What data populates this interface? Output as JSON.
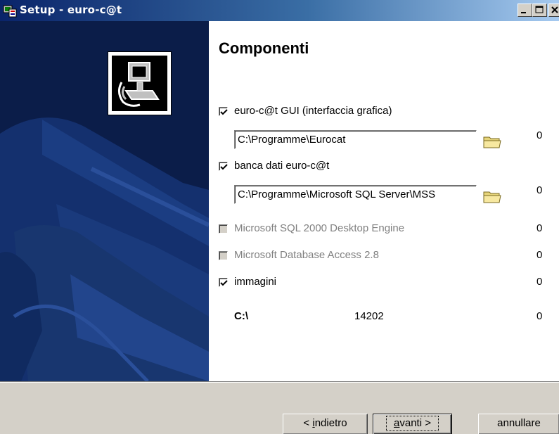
{
  "window": {
    "title": "Setup - euro-c@t"
  },
  "page": {
    "heading": "Componenti"
  },
  "components": [
    {
      "label": "euro-c@t GUI (interfaccia grafica)",
      "checked": true,
      "enabled": true,
      "path": "C:\\Programme\\Eurocat",
      "size": "0"
    },
    {
      "label": "banca dati euro-c@t",
      "checked": true,
      "enabled": true,
      "path": "C:\\Programme\\Microsoft SQL Server\\MSS",
      "size": "0"
    },
    {
      "label": "Microsoft SQL 2000 Desktop Engine",
      "checked": false,
      "enabled": false,
      "size": "0"
    },
    {
      "label": "Microsoft Database Access 2.8",
      "checked": false,
      "enabled": false,
      "size": "0"
    },
    {
      "label": "immagini",
      "checked": true,
      "enabled": true,
      "size": "0"
    }
  ],
  "disk": {
    "drive": "C:\\",
    "available": "14202",
    "required": "0"
  },
  "buttons": {
    "back": {
      "prefix": "< ",
      "accel": "i",
      "rest": "ndietro"
    },
    "next": {
      "accel": "a",
      "rest": "vanti >"
    },
    "cancel": "annullare"
  },
  "icons": {
    "title": "setup-icon",
    "logo": "computer-install-icon",
    "folder": "folder-icon"
  },
  "colors": {
    "titlebar_start": "#0a246a",
    "titlebar_end": "#a6caf0",
    "sidepanel": "#0b1d49",
    "dialog": "#d4d0c8"
  }
}
